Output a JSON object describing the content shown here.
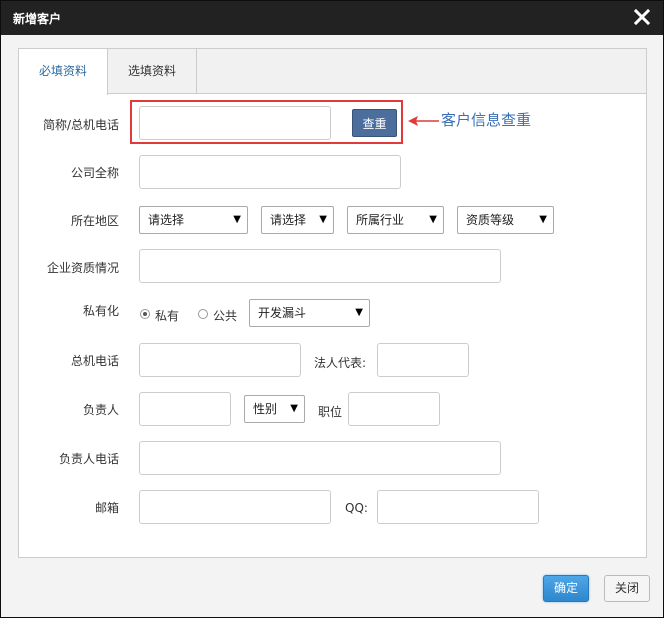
{
  "dialog": {
    "title": "新增客户",
    "tabs": [
      {
        "label": "必填资料",
        "active": true
      },
      {
        "label": "选填资料",
        "active": false
      }
    ]
  },
  "form": {
    "short_phone_label": "简称/总机电话",
    "short_phone_value": "",
    "check_button": "查重",
    "annotation": "客户信息查重",
    "full_name_label": "公司全称",
    "full_name_value": "",
    "region_label": "所在地区",
    "region_selects": [
      "请选择",
      "请选择"
    ],
    "industry_select": "所属行业",
    "level_select": "资质等级",
    "qualification_label": "企业资质情况",
    "qualification_value": "",
    "privacy_label": "私有化",
    "privacy_options": [
      "私有",
      "公共"
    ],
    "privacy_selected": "私有",
    "funnel_select": "开发漏斗",
    "main_phone_label": "总机电话",
    "main_phone_value": "",
    "legal_rep_label": "法人代表:",
    "legal_rep_value": "",
    "owner_label": "负责人",
    "owner_value": "",
    "gender_select": "性别",
    "position_label": "职位",
    "position_value": "",
    "owner_phone_label": "负责人电话",
    "owner_phone_value": "",
    "email_label": "邮箱",
    "email_value": "",
    "qq_label": "QQ:",
    "qq_value": ""
  },
  "footer": {
    "ok_label": "确定",
    "close_label": "关闭"
  },
  "colors": {
    "titlebar": "#222222",
    "highlight": "#e03a3a",
    "annotation": "#3a6fb5",
    "primary_button": "#2e86cc",
    "check_button": "#4c6e9c"
  }
}
